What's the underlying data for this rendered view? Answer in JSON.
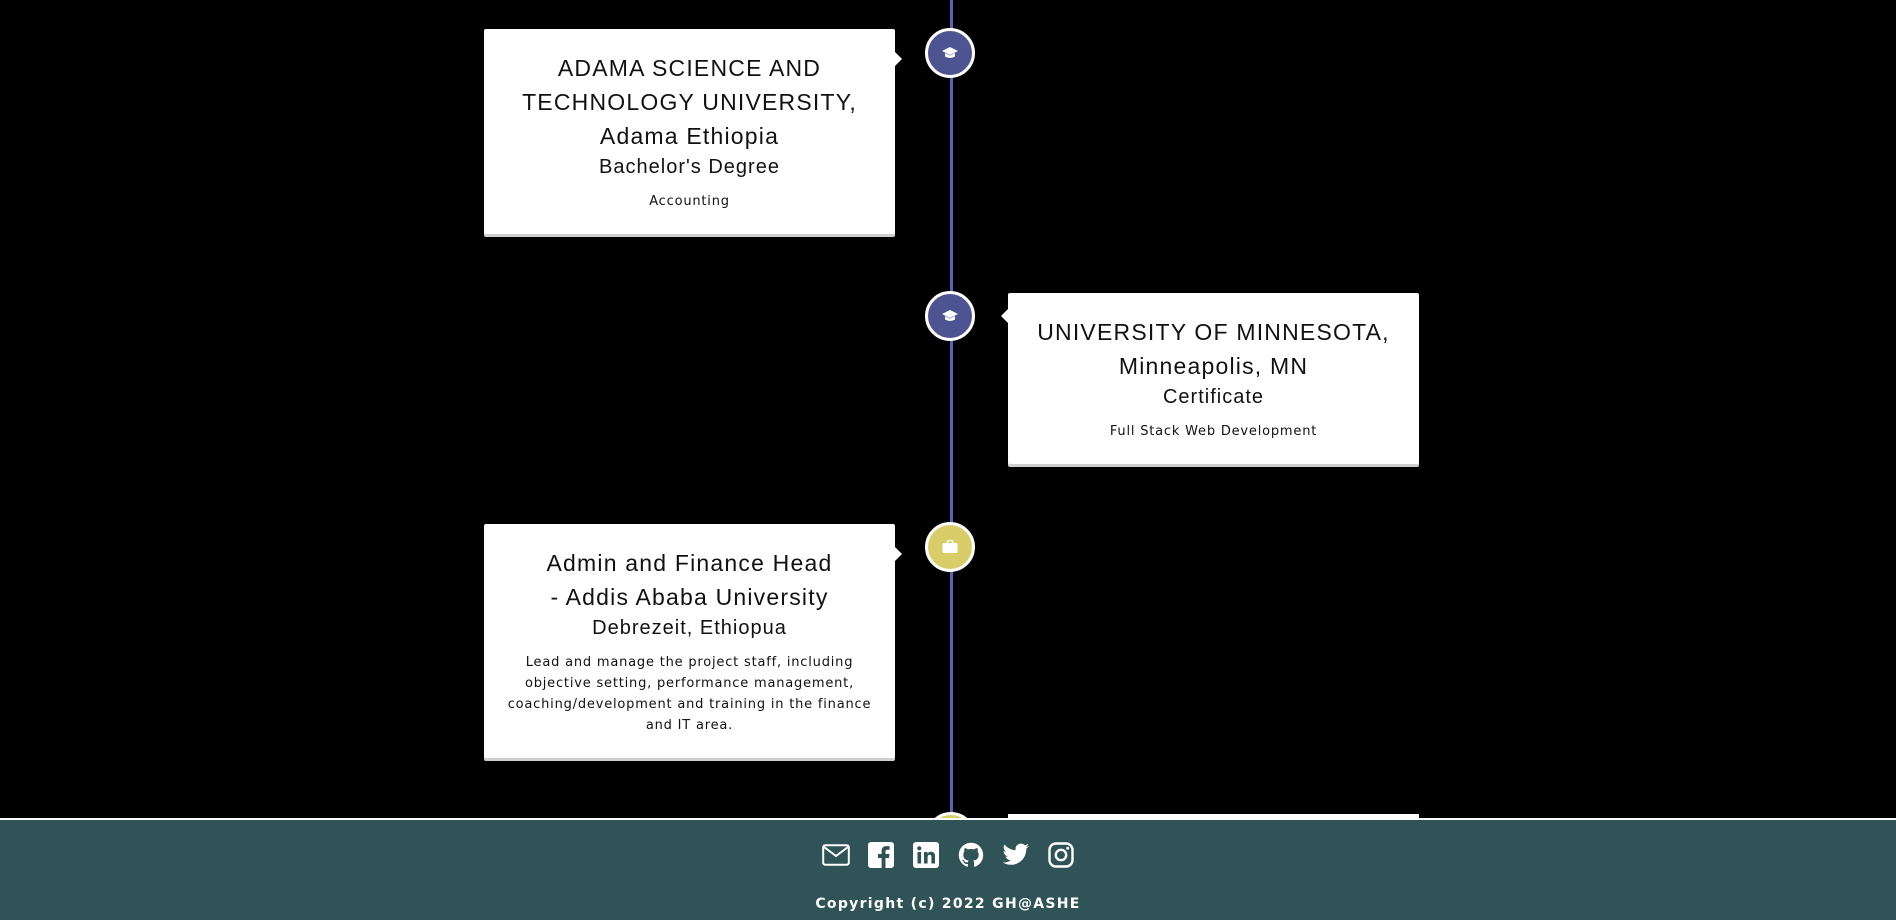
{
  "timeline": {
    "entries": [
      {
        "type": "education",
        "icon": "graduation-cap-icon",
        "side": "left",
        "title": "ADAMA SCIENCE AND TECHNOLOGY UNIVERSITY, Adama Ethiopia",
        "subtitle": "Bachelor's Degree",
        "description": "Accounting"
      },
      {
        "type": "education",
        "icon": "graduation-cap-icon",
        "side": "right",
        "title": "UNIVERSITY OF MINNESOTA, Minneapolis, MN",
        "subtitle": "Certificate",
        "description": "Full Stack Web Development"
      },
      {
        "type": "work",
        "icon": "briefcase-icon",
        "side": "left",
        "title": "Admin and Finance Head - Addis Ababa University",
        "subtitle": "Debrezeit, Ethiopua",
        "description": "Lead and manage the project staff, including objective setting, performance management, coaching/development and training in the finance and IT area."
      }
    ]
  },
  "colors": {
    "background": "#000000",
    "timeline_line": "#5b62b6",
    "education_marker": "#4e5391",
    "work_marker": "#d9cd6a",
    "footer": "#2f5356"
  },
  "footer": {
    "icons": [
      "mail-icon",
      "facebook-icon",
      "linkedin-icon",
      "github-icon",
      "twitter-icon",
      "instagram-icon"
    ],
    "copyright": "Copyright (c) 2022 GH@ASHE"
  }
}
